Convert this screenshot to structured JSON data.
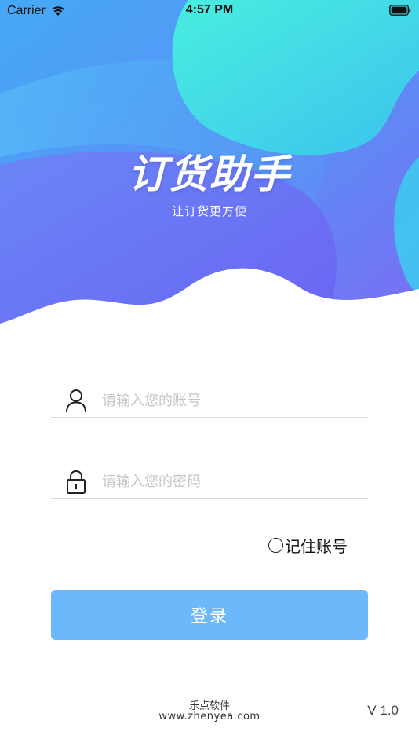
{
  "status_bar": {
    "carrier": "Carrier",
    "time": "4:57 PM",
    "wifi_icon": "wifi-icon",
    "battery_icon": "battery-icon"
  },
  "header": {
    "title": "订货助手",
    "subtitle": "让订货更方便"
  },
  "form": {
    "account": {
      "icon": "user-icon",
      "placeholder": "请输入您的账号",
      "value": ""
    },
    "password": {
      "icon": "lock-icon",
      "placeholder": "请输入您的密码",
      "value": ""
    },
    "remember": {
      "label": "记住账号",
      "checked": false
    },
    "login_label": "登录"
  },
  "footer": {
    "company": "乐点软件",
    "website": "www.zhenyea.com",
    "version": "V 1.0"
  },
  "colors": {
    "primary_button": "#6cb8fb",
    "gradient_blue": "#4aa3f5",
    "gradient_purple": "#7a6ff5",
    "gradient_cyan": "#3fdfe6"
  }
}
